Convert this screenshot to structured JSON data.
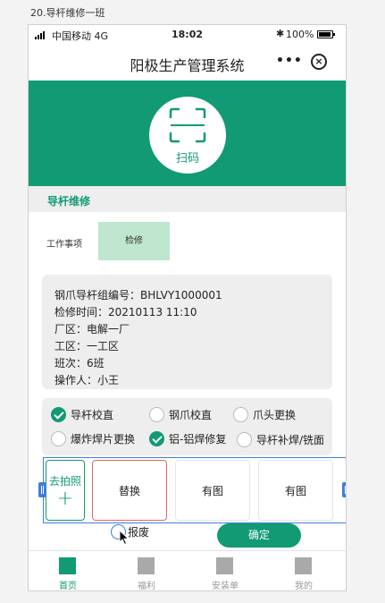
{
  "caption": "20.导杆维修一班",
  "statusbar": {
    "carrier": "中国移动",
    "network": "4G",
    "time": "18:02",
    "battery": "100%"
  },
  "navbar": {
    "title": "阳极生产管理系统",
    "more_label": "•••",
    "close_icon": "close-circle-icon"
  },
  "banner": {
    "scan_label": "扫码",
    "scan_icon": "scan-frame-icon",
    "color": "#119a74"
  },
  "section": {
    "title": "导杆维修"
  },
  "work": {
    "label": "工作事项",
    "item": "检修"
  },
  "info": {
    "lines": [
      "钢爪导杆组编号：BHLVY1000001",
      "检修时间：20210113 11:10",
      "厂区：电解一厂",
      "工区：一工区",
      "班次：6班",
      "操作人：小王"
    ]
  },
  "options": [
    {
      "label": "导杆校直",
      "checked": true
    },
    {
      "label": "钢爪校直",
      "checked": false
    },
    {
      "label": "爪头更换",
      "checked": false
    },
    {
      "label": "爆炸焊片更换",
      "checked": false
    },
    {
      "label": "铝-铝焊修复",
      "checked": true
    },
    {
      "label": "导杆补焊/铣面",
      "checked": false
    }
  ],
  "photos": {
    "add_label": "去拍照",
    "add_icon": "+",
    "cells": [
      "替换",
      "有图",
      "有图"
    ]
  },
  "scrap": {
    "label": "报废",
    "checked": false
  },
  "confirm_label": "确定",
  "tabs": [
    {
      "label": "首页",
      "active": true,
      "icon": "home-icon"
    },
    {
      "label": "福利",
      "active": false,
      "icon": "welfare-icon"
    },
    {
      "label": "安装单",
      "active": false,
      "icon": "install-order-icon"
    },
    {
      "label": "我的",
      "active": false,
      "icon": "profile-icon"
    }
  ]
}
